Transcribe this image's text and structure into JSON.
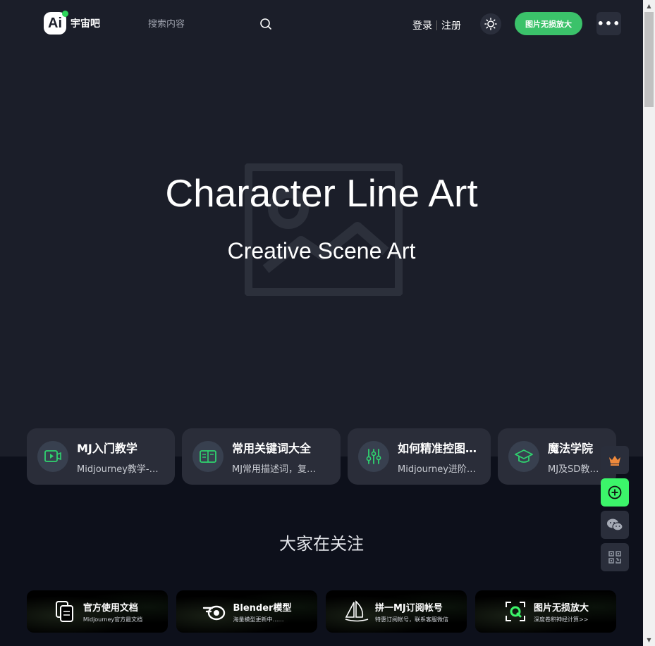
{
  "header": {
    "logo_mark": "Ai",
    "logo_text": "宇宙吧",
    "search_placeholder": "搜索内容",
    "login": "登录",
    "register": "注册",
    "cta": "图片无损放大",
    "more": "•••"
  },
  "hero": {
    "title": "Character Line Art",
    "subtitle": "Creative Scene Art"
  },
  "features": [
    {
      "title": "MJ入门教学",
      "desc": "Midjourney教学-…",
      "icon": "video-play-icon"
    },
    {
      "title": "常用关键词大全",
      "desc": "MJ常用描述词，复…",
      "icon": "book-icon"
    },
    {
      "title": "如何精准控图…",
      "desc": "Midjourney进阶…",
      "icon": "sliders-icon"
    },
    {
      "title": "魔法学院",
      "desc": "MJ及SD教…",
      "icon": "graduation-cap-icon"
    }
  ],
  "section": {
    "title": "大家在关注"
  },
  "banners": [
    {
      "title": "官方使用文档",
      "sub": "Midjourney官方最文档",
      "icon": "document-icon"
    },
    {
      "title": "Blender模型",
      "sub": "海量模型更新中……",
      "icon": "blender-icon"
    },
    {
      "title": "拼一MJ订阅帐号",
      "sub": "特惠订阅帐号，联系客服微信",
      "icon": "sailboat-icon"
    },
    {
      "title": "图片无损放大",
      "sub": "深度卷积神经计算>>",
      "icon": "zoom-q-icon"
    }
  ],
  "colors": {
    "hero_bg": "#1b1e29",
    "page_bg": "#0d1019",
    "card_bg": "#2a2d39",
    "accent_green": "#3bc26a",
    "icon_green": "#2fd36f",
    "float_green": "#3cf56a",
    "crown_orange": "#f08a3c"
  }
}
